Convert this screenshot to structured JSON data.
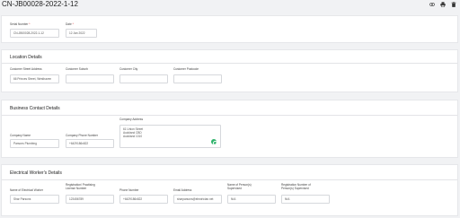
{
  "header": {
    "title": "CN-JB00028-2022-1-12",
    "icons": [
      "eye-icon",
      "print-icon",
      "delete-icon"
    ]
  },
  "general": {
    "serial_label": "Serial Number",
    "serial_value": "CN-JB00028-2022-1-12",
    "date_label": "Date",
    "date_value": "12 Jan 2022",
    "required_mark": "*"
  },
  "location": {
    "title": "Location Details",
    "street_label": "Customer Street Address",
    "street_value": "66 Princes Street, Westhaven",
    "suburb_label": "Customer Suburb",
    "suburb_value": "",
    "city_label": "Customer City",
    "city_value": "",
    "postcode_label": "Customer Postcode",
    "postcode_value": ""
  },
  "business": {
    "title": "Business Contact Details",
    "company_name_label": "Company Name",
    "company_name_value": "Parsons Plumbing",
    "company_phone_label": "Company Phone Number",
    "company_phone_value": "+6429186x822",
    "company_address_label": "Company Address",
    "company_address_lines": [
      "61 Union Street",
      "Auckland CBD",
      "Auckland 1010"
    ]
  },
  "worker": {
    "title": "Electrical Worker's Details",
    "name_label": "Name of Electrical Worker",
    "name_value": "Shar Parsons",
    "reg_label_1": "Registration/ Practising",
    "reg_label_2": "License Number",
    "reg_value": "123456789",
    "phone_label": "Phone Number",
    "phone_value": "+6429186x822",
    "email_label": "Email Address",
    "email_value": "sharparsons@electrician.net",
    "supervisor_label_1": "Name of Person(s)",
    "supervisor_label_2": "Supervised",
    "supervisor_value": "N/A",
    "supreg_label_1": "Registration Number of",
    "supreg_label_2": "Person(s) Supervised",
    "supreg_value": "N/A"
  }
}
